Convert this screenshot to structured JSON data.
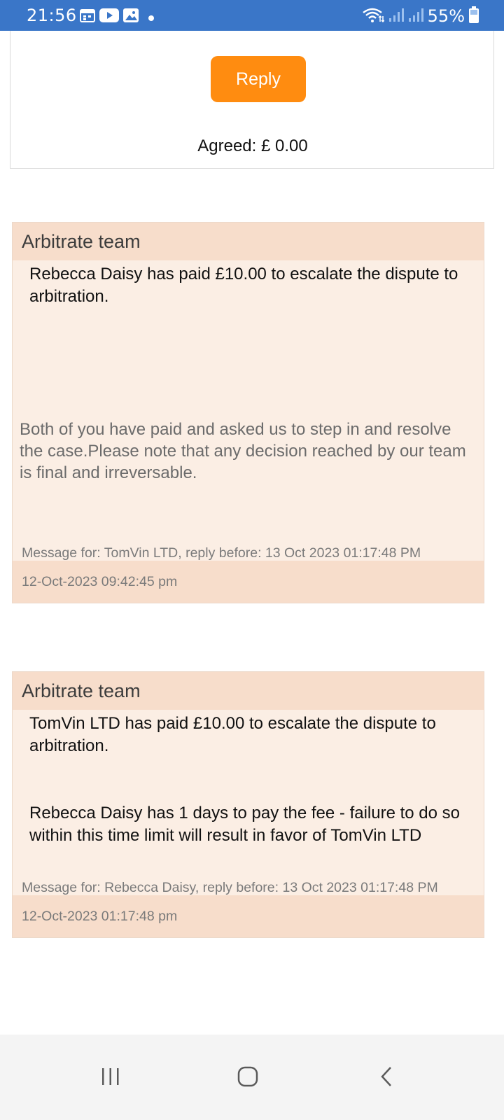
{
  "status_bar": {
    "time": "21:56",
    "battery": "55%",
    "background_color": "#3a76c8",
    "left_icons": [
      "calendar-icon",
      "youtube-icon",
      "gallery-icon",
      "notification-dot-icon"
    ],
    "right_icons": [
      "wifi-icon",
      "signal-icon",
      "signal-icon",
      "battery-icon"
    ]
  },
  "top_card": {
    "reply_label": "Reply",
    "reply_color": "#ff8c10",
    "agreed": "Agreed: £ 0.00"
  },
  "messages": [
    {
      "sender": "Arbitrate team",
      "body": "Rebecca Daisy has paid £10.00 to escalate the dispute to arbitration.",
      "note": "Both of you have paid and asked us to step in and resolve the case.Please note that any decision reached by our team is final and irreversable.",
      "message_for": "Message for: TomVin LTD, reply before: 13 Oct 2023 01:17:48 PM",
      "timestamp": "12-Oct-2023 09:42:45 pm"
    },
    {
      "sender": "Arbitrate team",
      "body": "TomVin LTD has paid £10.00 to escalate the dispute to arbitration.",
      "body2": "Rebecca Daisy has 1 days to pay the fee - failure to do so within this time limit will result in favor of TomVin LTD",
      "message_for": "Message for: Rebecca Daisy, reply before: 13 Oct 2023 01:17:48 PM",
      "timestamp": "12-Oct-2023 01:17:48 pm"
    }
  ],
  "nav_bar": {
    "buttons": [
      "recent-apps-icon",
      "home-icon",
      "back-icon"
    ]
  }
}
